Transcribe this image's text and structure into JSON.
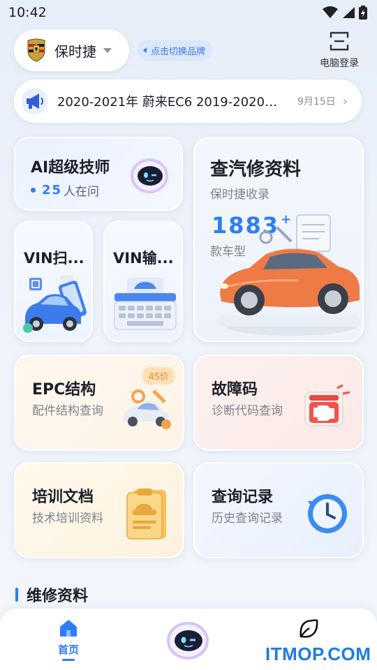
{
  "status": {
    "time": "10:42"
  },
  "header": {
    "brand_name": "保时捷",
    "switch_label": "点击切换品牌",
    "pc_login_label": "电脑登录"
  },
  "notice": {
    "text": "2020-2021年 蔚来EC6 2019-2020年...",
    "date": "9月15日"
  },
  "cards": {
    "ai": {
      "title": "AI超级技师",
      "count": "25",
      "count_suffix": "人在问"
    },
    "query": {
      "title": "查汽修资料",
      "subtitle": "保时捷收录",
      "count": "1883",
      "count_plus": "+",
      "unit": "款车型"
    },
    "vin_scan": {
      "title": "VIN扫..."
    },
    "vin_input": {
      "title": "VIN输..."
    },
    "epc": {
      "title": "EPC结构",
      "subtitle": "配件结构查询",
      "badge": "4S价"
    },
    "fault": {
      "title": "故障码",
      "subtitle": "诊断代码查询"
    },
    "training": {
      "title": "培训文档",
      "subtitle": "技术培训资料"
    },
    "history": {
      "title": "查询记录",
      "subtitle": "历史查询记录"
    }
  },
  "section": {
    "title": "维修资料"
  },
  "tabbar": {
    "home_label": "首页"
  },
  "watermark": "ITMOP.COM",
  "colors": {
    "accent": "#2f7cf6",
    "orange": "#e58a1f"
  }
}
